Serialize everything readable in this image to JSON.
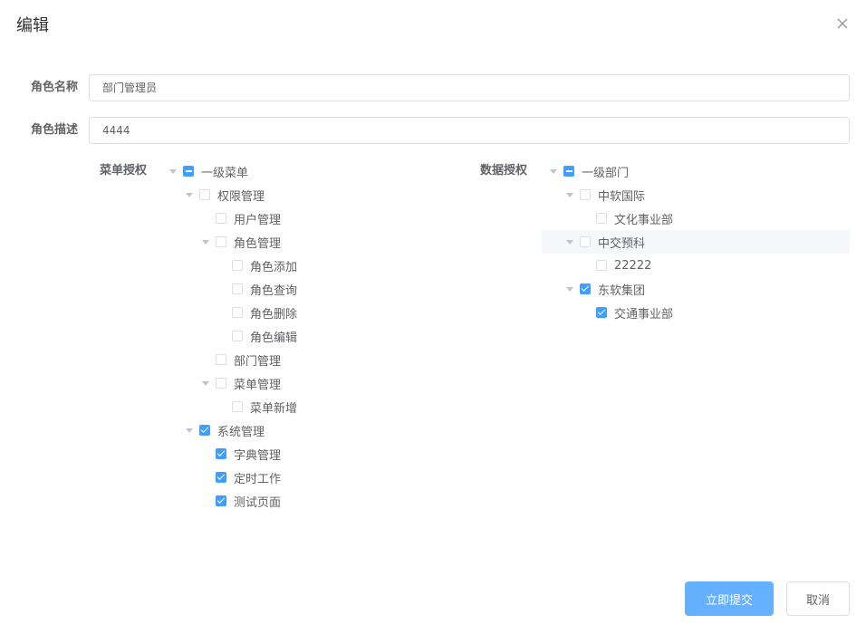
{
  "dialog": {
    "title": "编辑",
    "close_icon": "close-icon"
  },
  "form": {
    "role_name": {
      "label": "角色名称",
      "value": "部门管理员"
    },
    "role_desc": {
      "label": "角色描述",
      "value": "4444"
    }
  },
  "menu_tree": {
    "label": "菜单授权",
    "nodes": [
      {
        "label": "一级菜单",
        "state": "indeterminate",
        "expanded": true
      },
      {
        "label": "权限管理",
        "state": "unchecked",
        "expanded": true
      },
      {
        "label": "用户管理",
        "state": "unchecked"
      },
      {
        "label": "角色管理",
        "state": "unchecked",
        "expanded": true
      },
      {
        "label": "角色添加",
        "state": "unchecked"
      },
      {
        "label": "角色查询",
        "state": "unchecked"
      },
      {
        "label": "角色删除",
        "state": "unchecked"
      },
      {
        "label": "角色编辑",
        "state": "unchecked"
      },
      {
        "label": "部门管理",
        "state": "unchecked"
      },
      {
        "label": "菜单管理",
        "state": "unchecked",
        "expanded": true
      },
      {
        "label": "菜单新增",
        "state": "unchecked"
      },
      {
        "label": "系统管理",
        "state": "checked",
        "expanded": true
      },
      {
        "label": "字典管理",
        "state": "checked"
      },
      {
        "label": "定时工作",
        "state": "checked"
      },
      {
        "label": "测试页面",
        "state": "checked"
      }
    ]
  },
  "data_tree": {
    "label": "数据授权",
    "nodes": [
      {
        "label": "一级部门",
        "state": "indeterminate",
        "expanded": true
      },
      {
        "label": "中软国际",
        "state": "unchecked",
        "expanded": true
      },
      {
        "label": "文化事业部",
        "state": "unchecked"
      },
      {
        "label": "中交预科",
        "state": "unchecked",
        "expanded": true,
        "hovered": true
      },
      {
        "label": "22222",
        "state": "unchecked"
      },
      {
        "label": "东软集团",
        "state": "checked",
        "expanded": true
      },
      {
        "label": "交通事业部",
        "state": "checked"
      }
    ]
  },
  "footer": {
    "submit_label": "立即提交",
    "cancel_label": "取消"
  },
  "colors": {
    "primary": "#409eff",
    "primary_light": "#66b1ff"
  }
}
